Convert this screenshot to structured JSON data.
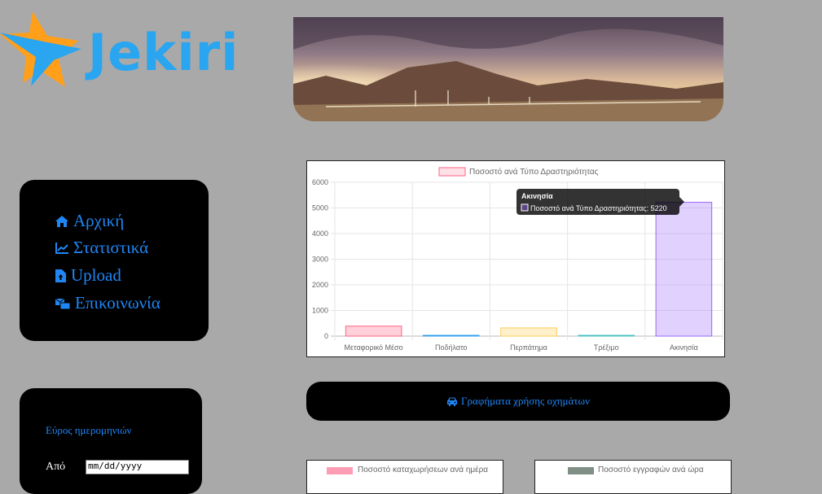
{
  "logo": {
    "text": "Jekiri",
    "colors": {
      "orange": "#ff9f1a",
      "blue": "#2aa5f0"
    }
  },
  "banner": {
    "image": "sunset-mountains-bridge"
  },
  "nav": {
    "items": [
      {
        "icon": "home-icon",
        "label": "Αρχική"
      },
      {
        "icon": "chart-line-icon",
        "label": "Στατιστικά"
      },
      {
        "icon": "file-upload-icon",
        "label": "Upload"
      },
      {
        "icon": "contact-icon",
        "label": "Επικοινωνία"
      }
    ]
  },
  "date_range": {
    "title": "Εύρος ημερομηνιών",
    "from_label": "Από",
    "from_value": "mm/dd/yyyy"
  },
  "vehicle_button": {
    "icon": "car-icon",
    "label": "Γραφήματα χρήσης οχημάτων"
  },
  "tooltip": {
    "title": "Ακινησία",
    "text": "Ποσοστό ανά Τύπο Δραστηριότητας: 5220"
  },
  "chart_data": [
    {
      "type": "bar",
      "legend": "Ποσοστό ανά Τύπο Δραστηριότητας",
      "categories": [
        "Μεταφορικό Μέσο",
        "Ποδήλατο",
        "Περπάτημα",
        "Τρέξιμο",
        "Ακινησία"
      ],
      "values": [
        390,
        5,
        320,
        0,
        5220
      ],
      "colors": [
        "#ff6384",
        "#36a2eb",
        "#ffce56",
        "#4bc0c0",
        "#9966ff"
      ],
      "ylim": [
        0,
        6000
      ],
      "yticks": [
        "6000",
        "5000",
        "4000",
        "3000",
        "2000",
        "1000",
        "0"
      ],
      "grid": true,
      "legend_position": "top"
    },
    {
      "type": "bar",
      "legend": "Ποσοστό καταχωρήσεων ανά ημέρα",
      "legend_color": "#ff9db5"
    },
    {
      "type": "bar",
      "legend": "Ποσοστό εγγραφών ανά ώρα",
      "legend_color": "#7f8f86"
    }
  ]
}
